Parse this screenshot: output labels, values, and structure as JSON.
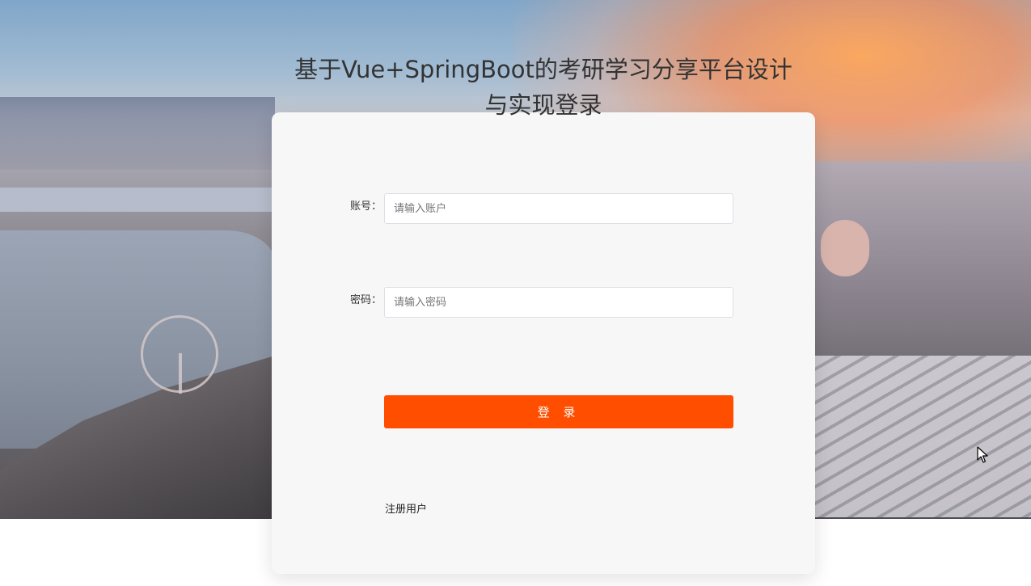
{
  "page": {
    "title": "基于Vue+SpringBoot的考研学习分享平台设计与实现登录",
    "title_line1": "基于Vue+SpringBoot的考研学习分享平台设计",
    "title_line2": "与实现登录"
  },
  "form": {
    "account_label": "账号：",
    "account_placeholder": "请输入账户",
    "account_value": "",
    "password_label": "密码：",
    "password_placeholder": "请输入密码",
    "password_value": "",
    "login_button": "登 录",
    "register_link": "注册用户"
  },
  "colors": {
    "accent": "#ff4e00",
    "card_background": "#f7f7f7",
    "title_text": "#333333"
  },
  "icons": {
    "cursor": "mouse-pointer-icon"
  }
}
